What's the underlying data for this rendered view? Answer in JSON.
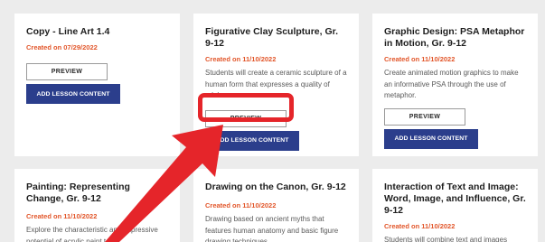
{
  "cards": [
    {
      "title": "Copy - Line Art 1.4",
      "date": "Created on 07/29/2022",
      "description": "",
      "preview_label": "PREVIEW",
      "add_label": "ADD LESSON CONTENT"
    },
    {
      "title": "Figurative Clay Sculpture, Gr. 9-12",
      "date": "Created on 11/10/2022",
      "description": "Students will create a ceramic sculpture of a human form that expresses a quality of adolescence.",
      "preview_label": "PREVIEW",
      "add_label": "ADD LESSON CONTENT"
    },
    {
      "title": "Graphic Design: PSA Metaphor in Motion, Gr. 9-12",
      "date": "Created on 11/10/2022",
      "description": "Create animated motion graphics to make an informative PSA through the use of metaphor.",
      "preview_label": "PREVIEW",
      "add_label": "ADD LESSON CONTENT"
    },
    {
      "title": "Painting: Representing Change, Gr. 9-12",
      "date": "Created on 11/10/2022",
      "description": "Explore the characteristic and expressive potential of acrylic paint to"
    },
    {
      "title": "Drawing on the Canon, Gr. 9-12",
      "date": "Created on 11/10/2022",
      "description": "Drawing based on ancient myths that features human anatomy and basic figure drawing techniques."
    },
    {
      "title": "Interaction of Text and Image: Word, Image, and Influence, Gr. 9-12",
      "date": "Created on 11/10/2022",
      "description": "Students will combine text and images"
    }
  ],
  "colors": {
    "background": "#ececec",
    "card": "#ffffff",
    "date": "#e2562a",
    "add_button": "#2b3e8c",
    "annotation": "#e5252a"
  }
}
